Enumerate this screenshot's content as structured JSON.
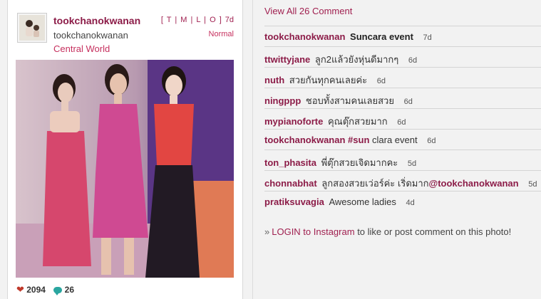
{
  "post": {
    "username": "tookchanokwanan",
    "full_name": "tookchanokwanan",
    "location": "Central World",
    "sizes": "[ T | M | L | O ]",
    "age": "7d",
    "filter": "Normal",
    "likes": "2094",
    "comments_count": "26"
  },
  "comments_panel": {
    "view_all": "View All 26 Comment",
    "items": [
      {
        "user": "tookchanokwanan",
        "text": "Suncara event",
        "time": "7d",
        "text_bold": true
      },
      {
        "user": "ttwittyjane",
        "text": "ลูก2แล้วยังหุ่นดีมากๆ",
        "time": "6d"
      },
      {
        "user": "nuth",
        "text": "สวยกันทุกคนเลยค่ะ",
        "time": "6d"
      },
      {
        "user": "ningppp",
        "text": "ชอบทั้งสามคนเลยสวย",
        "time": "6d"
      },
      {
        "user": "mypianoforte",
        "text": "คุณตุ๊กสวยมาก",
        "time": "6d"
      },
      {
        "user": "tookchanokwanan",
        "text_tag": "#sun",
        "text": "clara event",
        "time": "6d"
      },
      {
        "user": "ton_phasita",
        "text": "พี่ตุ๊กสวยเจิดมากคะ",
        "time": "5d"
      },
      {
        "user": "chonnabhat",
        "text": "ลูกสองสวยเว่อร์ค่ะ เริ่ดมาก",
        "text_mention": "@tookchanokwanan",
        "time": "5d"
      },
      {
        "user": "pratiksuvagia",
        "text": "Awesome ladies",
        "time": "4d"
      }
    ],
    "login_prefix": "»",
    "login_link": "LOGIN to Instagram",
    "login_suffix": "to like or post comment on this photo!"
  },
  "colors": {
    "accent": "#8c1c48",
    "link": "#a02050",
    "likes_heart": "#c0392b",
    "comment_bubble": "#2aa6a0"
  },
  "icons": [
    "heart-icon",
    "comment-bubble-icon"
  ]
}
